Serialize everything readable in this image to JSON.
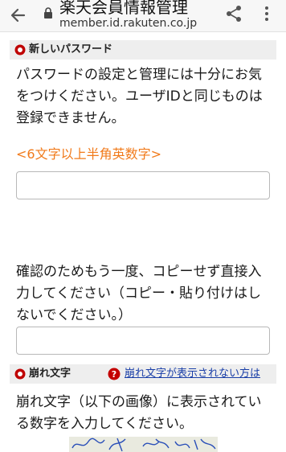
{
  "header": {
    "title": "楽天会員情報管理",
    "url": "member.id.rakuten.co.jp"
  },
  "new_password": {
    "section_label": "新しいパスワード",
    "description": "パスワードの設定と管理には十分にお気をつけください。ユーザIDと同じものは登録できません。",
    "requirement": "<6文字以上半角英数字>",
    "value": ""
  },
  "confirm_password": {
    "description": "確認のためもう一度、コピーせず直接入力してください（コピー・貼り付けはしないでください。）",
    "value": ""
  },
  "captcha": {
    "section_label": "崩れ文字",
    "help_link": "崩れ文字が表示されない方は",
    "description": "崩れ文字（以下の画像）に表示されている数字を入力してください。"
  },
  "colors": {
    "accent": "#f17a1a",
    "badge_red": "#bf0000",
    "link_blue": "#1a3fa8"
  }
}
